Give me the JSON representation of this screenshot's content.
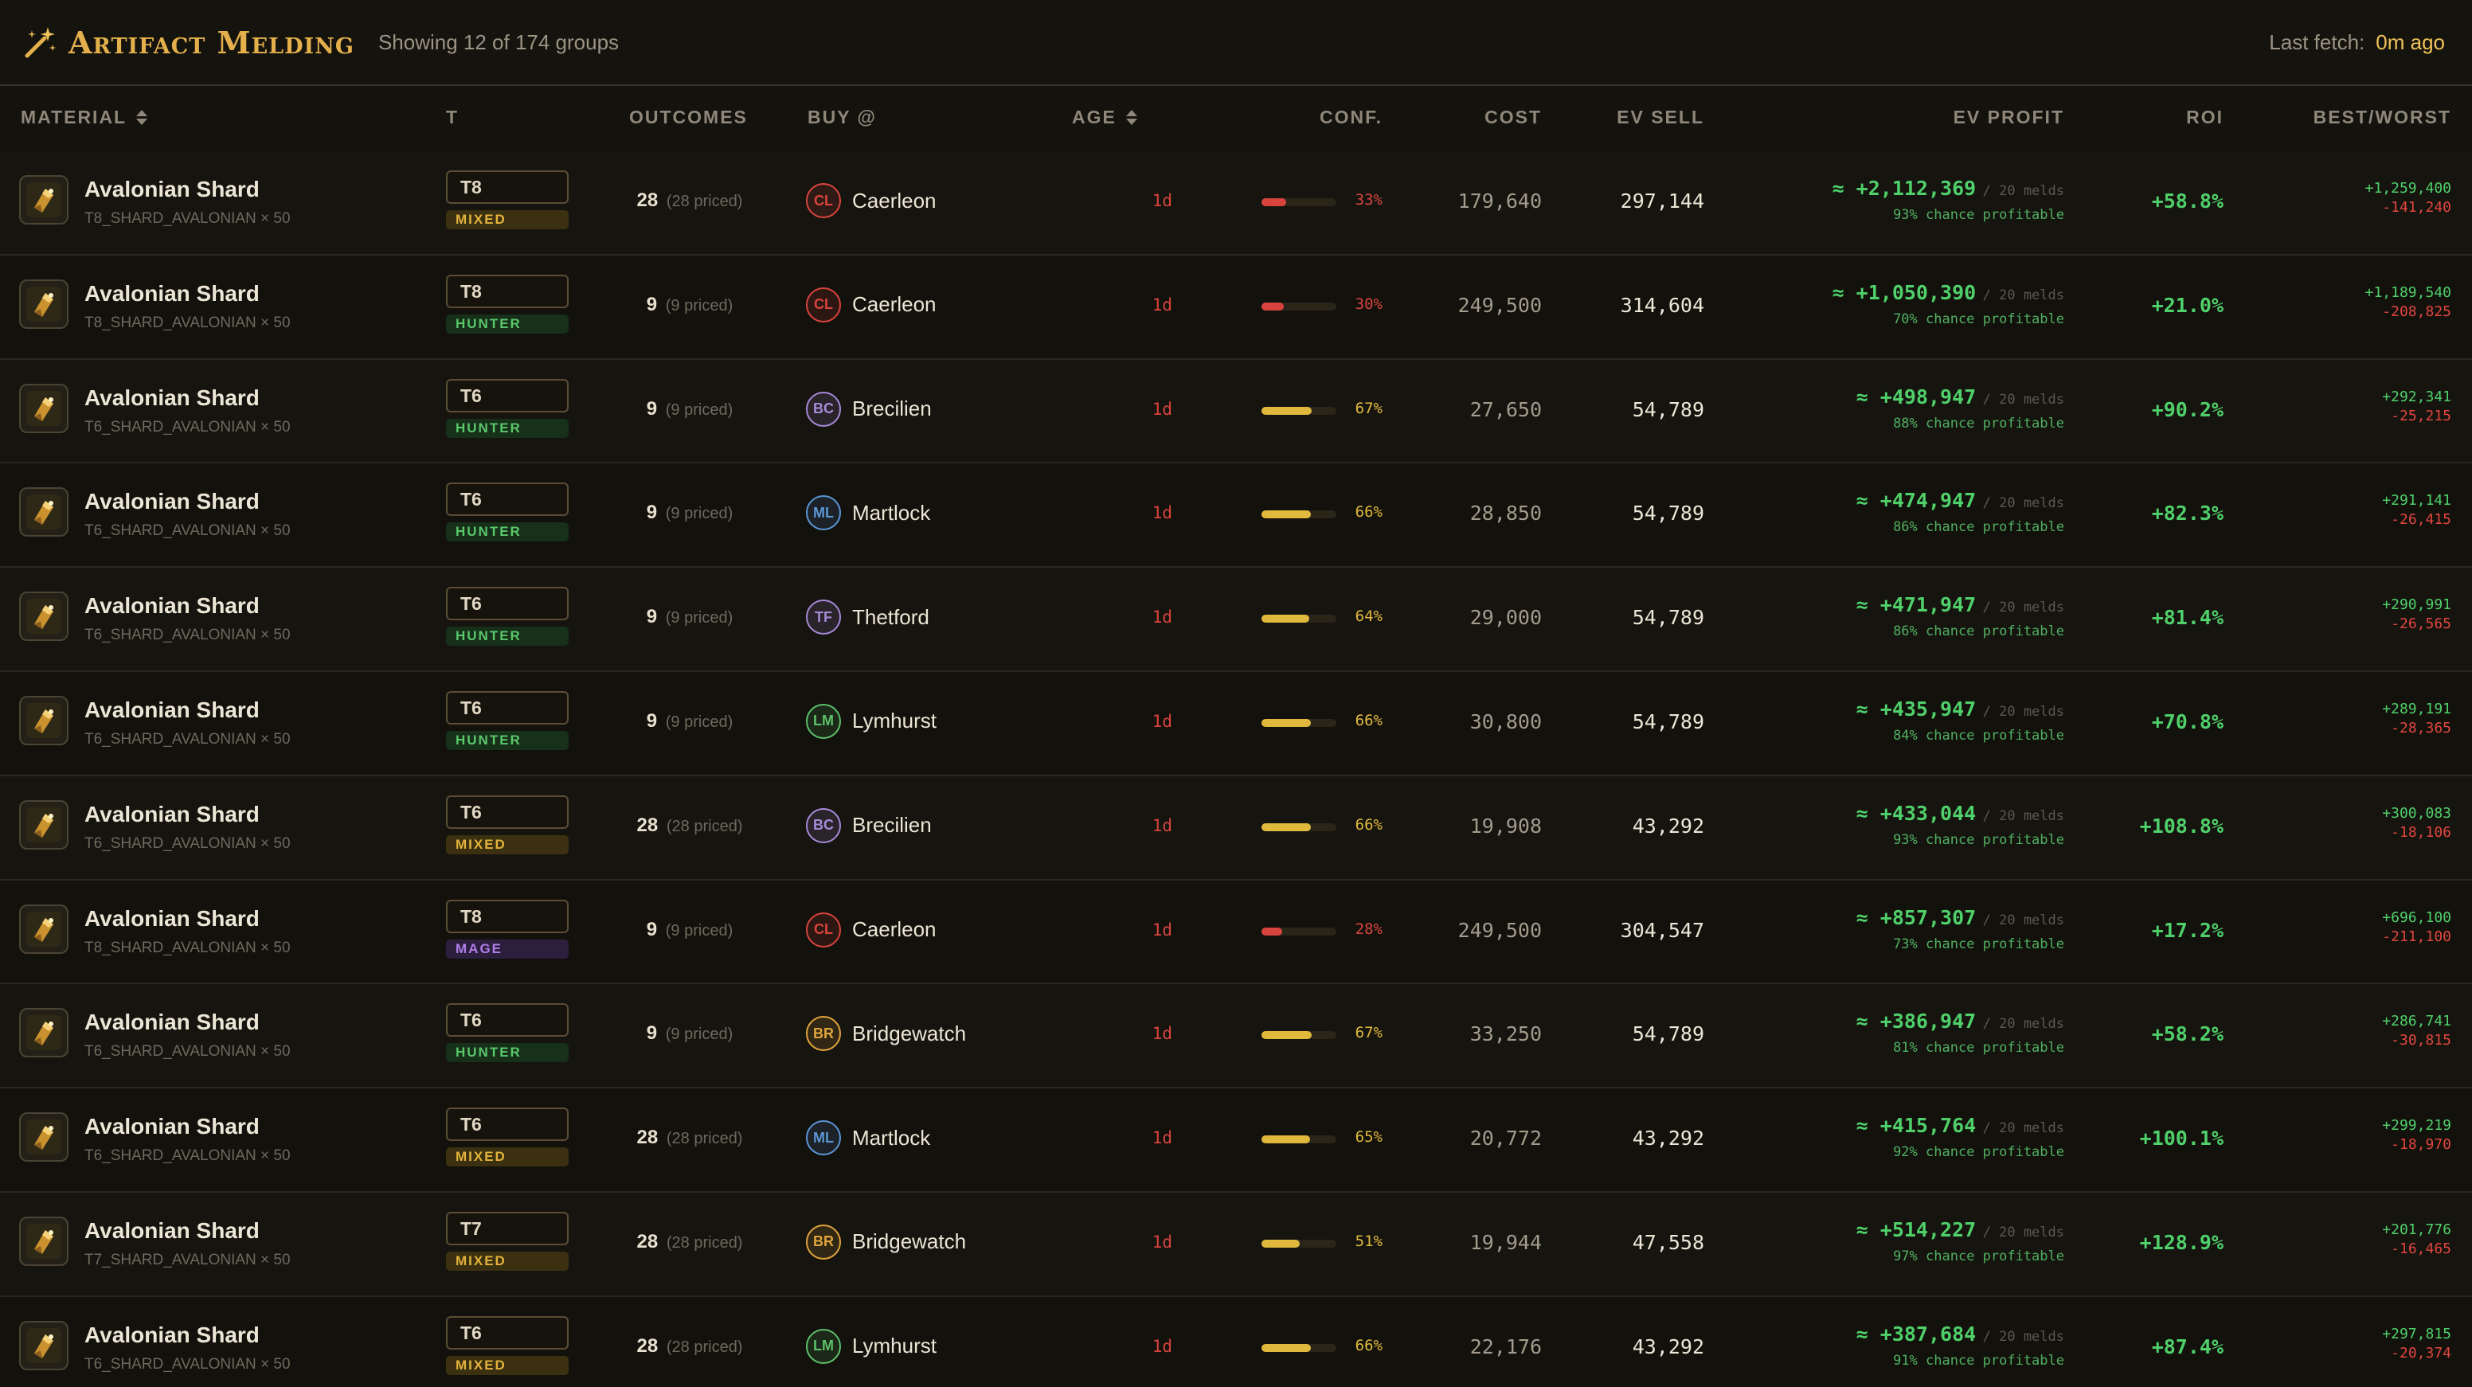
{
  "header": {
    "title": "Artifact Melding",
    "subtitle": "Showing 12 of 174 groups",
    "last_fetch_label": "Last fetch:",
    "last_fetch_value": "0m ago",
    "icon": "magic-wand-icon"
  },
  "columns": {
    "material": "MATERIAL",
    "tier": "T",
    "outcomes": "OUTCOMES",
    "buy": "BUY @",
    "age": "AGE",
    "conf": "CONF.",
    "cost": "COST",
    "ev_sell": "EV SELL",
    "ev_profit": "EV PROFIT",
    "roi": "ROI",
    "best_worst": "BEST/WORST"
  },
  "colors": {
    "accent": "#e4b04c",
    "profit_green": "#4fd06a",
    "loss_red": "#e0463f",
    "conf_low": "#d8443d",
    "conf_mid": "#e0b93c"
  },
  "rows": [
    {
      "name": "Avalonian Shard",
      "id": "T8_SHARD_AVALONIAN × 50",
      "tier": "T8",
      "kind": "MIXED",
      "kind_class": "mixed",
      "outcomes": "28",
      "priced": "(28 priced)",
      "city_code": "CL",
      "city": "Caerleon",
      "city_color": "#d8443d",
      "age": "1d",
      "conf": 0.33,
      "conf_label": "33%",
      "cost": "179,640",
      "ev_sell": "297,144",
      "ev_profit": "≈ +2,112,369",
      "melds": "/ 20 melds",
      "chance": "93% chance profitable",
      "roi": "+58.8%",
      "best": "+1,259,400",
      "worst": "-141,240"
    },
    {
      "name": "Avalonian Shard",
      "id": "T8_SHARD_AVALONIAN × 50",
      "tier": "T8",
      "kind": "HUNTER",
      "kind_class": "hunter",
      "outcomes": "9",
      "priced": "(9 priced)",
      "city_code": "CL",
      "city": "Caerleon",
      "city_color": "#d8443d",
      "age": "1d",
      "conf": 0.3,
      "conf_label": "30%",
      "cost": "249,500",
      "ev_sell": "314,604",
      "ev_profit": "≈ +1,050,390",
      "melds": "/ 20 melds",
      "chance": "70% chance profitable",
      "roi": "+21.0%",
      "best": "+1,189,540",
      "worst": "-208,825"
    },
    {
      "name": "Avalonian Shard",
      "id": "T6_SHARD_AVALONIAN × 50",
      "tier": "T6",
      "kind": "HUNTER",
      "kind_class": "hunter",
      "outcomes": "9",
      "priced": "(9 priced)",
      "city_code": "BC",
      "city": "Brecilien",
      "city_color": "#a58ad8",
      "age": "1d",
      "conf": 0.67,
      "conf_label": "67%",
      "cost": "27,650",
      "ev_sell": "54,789",
      "ev_profit": "≈ +498,947",
      "melds": "/ 20 melds",
      "chance": "88% chance profitable",
      "roi": "+90.2%",
      "best": "+292,341",
      "worst": "-25,215"
    },
    {
      "name": "Avalonian Shard",
      "id": "T6_SHARD_AVALONIAN × 50",
      "tier": "T6",
      "kind": "HUNTER",
      "kind_class": "hunter",
      "outcomes": "9",
      "priced": "(9 priced)",
      "city_code": "ML",
      "city": "Martlock",
      "city_color": "#5b95d6",
      "age": "1d",
      "conf": 0.66,
      "conf_label": "66%",
      "cost": "28,850",
      "ev_sell": "54,789",
      "ev_profit": "≈ +474,947",
      "melds": "/ 20 melds",
      "chance": "86% chance profitable",
      "roi": "+82.3%",
      "best": "+291,141",
      "worst": "-26,415"
    },
    {
      "name": "Avalonian Shard",
      "id": "T6_SHARD_AVALONIAN × 50",
      "tier": "T6",
      "kind": "HUNTER",
      "kind_class": "hunter",
      "outcomes": "9",
      "priced": "(9 priced)",
      "city_code": "TF",
      "city": "Thetford",
      "city_color": "#a58ad8",
      "age": "1d",
      "conf": 0.64,
      "conf_label": "64%",
      "cost": "29,000",
      "ev_sell": "54,789",
      "ev_profit": "≈ +471,947",
      "melds": "/ 20 melds",
      "chance": "86% chance profitable",
      "roi": "+81.4%",
      "best": "+290,991",
      "worst": "-26,565"
    },
    {
      "name": "Avalonian Shard",
      "id": "T6_SHARD_AVALONIAN × 50",
      "tier": "T6",
      "kind": "HUNTER",
      "kind_class": "hunter",
      "outcomes": "9",
      "priced": "(9 priced)",
      "city_code": "LM",
      "city": "Lymhurst",
      "city_color": "#5cc06a",
      "age": "1d",
      "conf": 0.66,
      "conf_label": "66%",
      "cost": "30,800",
      "ev_sell": "54,789",
      "ev_profit": "≈ +435,947",
      "melds": "/ 20 melds",
      "chance": "84% chance profitable",
      "roi": "+70.8%",
      "best": "+289,191",
      "worst": "-28,365"
    },
    {
      "name": "Avalonian Shard",
      "id": "T6_SHARD_AVALONIAN × 50",
      "tier": "T6",
      "kind": "MIXED",
      "kind_class": "mixed",
      "outcomes": "28",
      "priced": "(28 priced)",
      "city_code": "BC",
      "city": "Brecilien",
      "city_color": "#a58ad8",
      "age": "1d",
      "conf": 0.66,
      "conf_label": "66%",
      "cost": "19,908",
      "ev_sell": "43,292",
      "ev_profit": "≈ +433,044",
      "melds": "/ 20 melds",
      "chance": "93% chance profitable",
      "roi": "+108.8%",
      "best": "+300,083",
      "worst": "-18,106"
    },
    {
      "name": "Avalonian Shard",
      "id": "T8_SHARD_AVALONIAN × 50",
      "tier": "T8",
      "kind": "MAGE",
      "kind_class": "mage",
      "outcomes": "9",
      "priced": "(9 priced)",
      "city_code": "CL",
      "city": "Caerleon",
      "city_color": "#d8443d",
      "age": "1d",
      "conf": 0.28,
      "conf_label": "28%",
      "cost": "249,500",
      "ev_sell": "304,547",
      "ev_profit": "≈ +857,307",
      "melds": "/ 20 melds",
      "chance": "73% chance profitable",
      "roi": "+17.2%",
      "best": "+696,100",
      "worst": "-211,100"
    },
    {
      "name": "Avalonian Shard",
      "id": "T6_SHARD_AVALONIAN × 50",
      "tier": "T6",
      "kind": "HUNTER",
      "kind_class": "hunter",
      "outcomes": "9",
      "priced": "(9 priced)",
      "city_code": "BR",
      "city": "Bridgewatch",
      "city_color": "#e0a43c",
      "age": "1d",
      "conf": 0.67,
      "conf_label": "67%",
      "cost": "33,250",
      "ev_sell": "54,789",
      "ev_profit": "≈ +386,947",
      "melds": "/ 20 melds",
      "chance": "81% chance profitable",
      "roi": "+58.2%",
      "best": "+286,741",
      "worst": "-30,815"
    },
    {
      "name": "Avalonian Shard",
      "id": "T6_SHARD_AVALONIAN × 50",
      "tier": "T6",
      "kind": "MIXED",
      "kind_class": "mixed",
      "outcomes": "28",
      "priced": "(28 priced)",
      "city_code": "ML",
      "city": "Martlock",
      "city_color": "#5b95d6",
      "age": "1d",
      "conf": 0.65,
      "conf_label": "65%",
      "cost": "20,772",
      "ev_sell": "43,292",
      "ev_profit": "≈ +415,764",
      "melds": "/ 20 melds",
      "chance": "92% chance profitable",
      "roi": "+100.1%",
      "best": "+299,219",
      "worst": "-18,970"
    },
    {
      "name": "Avalonian Shard",
      "id": "T7_SHARD_AVALONIAN × 50",
      "tier": "T7",
      "kind": "MIXED",
      "kind_class": "mixed",
      "outcomes": "28",
      "priced": "(28 priced)",
      "city_code": "BR",
      "city": "Bridgewatch",
      "city_color": "#e0a43c",
      "age": "1d",
      "conf": 0.51,
      "conf_label": "51%",
      "cost": "19,944",
      "ev_sell": "47,558",
      "ev_profit": "≈ +514,227",
      "melds": "/ 20 melds",
      "chance": "97% chance profitable",
      "roi": "+128.9%",
      "best": "+201,776",
      "worst": "-16,465"
    },
    {
      "name": "Avalonian Shard",
      "id": "T6_SHARD_AVALONIAN × 50",
      "tier": "T6",
      "kind": "MIXED",
      "kind_class": "mixed",
      "outcomes": "28",
      "priced": "(28 priced)",
      "city_code": "LM",
      "city": "Lymhurst",
      "city_color": "#5cc06a",
      "age": "1d",
      "conf": 0.66,
      "conf_label": "66%",
      "cost": "22,176",
      "ev_sell": "43,292",
      "ev_profit": "≈ +387,684",
      "melds": "/ 20 melds",
      "chance": "91% chance profitable",
      "roi": "+87.4%",
      "best": "+297,815",
      "worst": "-20,374"
    }
  ]
}
